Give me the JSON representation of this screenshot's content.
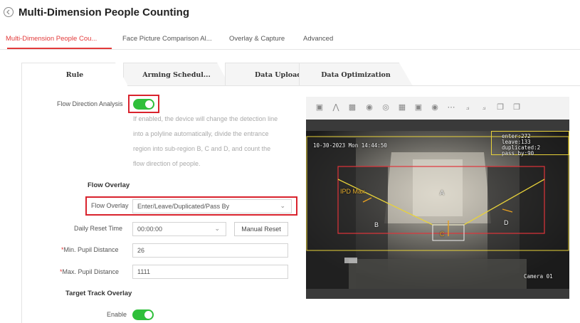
{
  "header": {
    "title": "Multi-Dimension People Counting"
  },
  "top_tabs": [
    {
      "label": "Multi-Dimension People Cou..."
    },
    {
      "label": "Face Picture Comparison Al..."
    },
    {
      "label": "Overlay & Capture"
    },
    {
      "label": "Advanced"
    }
  ],
  "inner_tabs": [
    {
      "label": "Rule"
    },
    {
      "label": "Arming Schedul..."
    },
    {
      "label": "Data Upload"
    },
    {
      "label": "Data Optimization"
    }
  ],
  "form": {
    "flow_direction_label": "Flow Direction Analysis",
    "flow_direction_enabled": true,
    "hint_lines": [
      "If enabled, the device will change the detection line",
      "into a polyline automatically, divide the entrance",
      "region into sub-region B, C and D, and count the",
      "flow direction of people."
    ],
    "flow_overlay_section": "Flow Overlay",
    "flow_overlay_label": "Flow Overlay",
    "flow_overlay_value": "Enter/Leave/Duplicated/Pass By",
    "daily_reset_label": "Daily Reset Time",
    "daily_reset_value": "00:00:00",
    "manual_reset_label": "Manual Reset",
    "min_pupil_label": "Min. Pupil Distance",
    "min_pupil_value": "26",
    "max_pupil_label": "Max. Pupil Distance",
    "max_pupil_value": "1111",
    "required_mark": "*",
    "target_track_section": "Target Track Overlay",
    "enable_label": "Enable",
    "enable_enabled": true
  },
  "video": {
    "timestamp": "10-30-2023 Mon 14:44:50",
    "stats": {
      "enter": "enter:272",
      "leave": "leave:133",
      "duplicated": "duplicated:2",
      "passby": "pass by:90"
    },
    "camera_label": "Camera 01",
    "max_label": "IPD Max",
    "regions": [
      "A",
      "B",
      "C",
      "D"
    ]
  },
  "colors": {
    "accent": "#e23a3a",
    "toggle_on": "#2fbf3a",
    "highlight": "#d9232d"
  }
}
